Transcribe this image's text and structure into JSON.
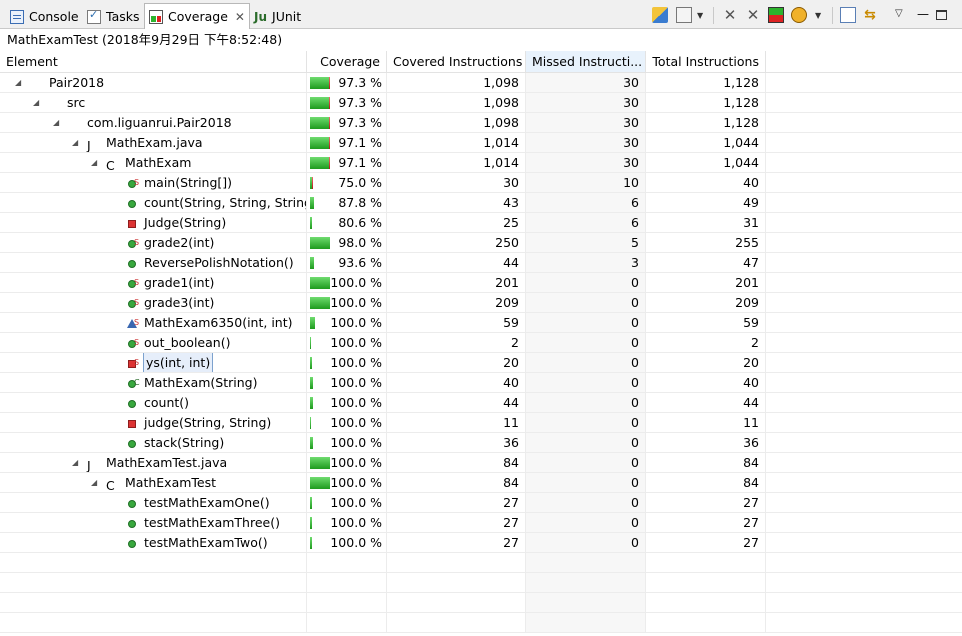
{
  "tabs": [
    {
      "label": "Console",
      "icon": "console-icon"
    },
    {
      "label": "Tasks",
      "icon": "tasks-icon"
    },
    {
      "label": "Coverage",
      "icon": "coverage-icon",
      "active": true
    },
    {
      "label": "JUnit",
      "icon": "junit-icon"
    }
  ],
  "session_title": "MathExamTest (2018年9月29日 下午8:52:48)",
  "columns": {
    "element": "Element",
    "coverage": "Coverage",
    "covered": "Covered Instructions",
    "missed": "Missed Instructi...",
    "total": "Total Instructions"
  },
  "rows": [
    {
      "label": "Pair2018",
      "type": "project",
      "depth": 0,
      "expanded": true,
      "coverage": "97.3 %",
      "pct": 97.3,
      "covered": "1,098",
      "missed": "30",
      "total": "1,128"
    },
    {
      "label": "src",
      "type": "source-folder",
      "depth": 1,
      "expanded": true,
      "coverage": "97.3 %",
      "pct": 97.3,
      "covered": "1,098",
      "missed": "30",
      "total": "1,128"
    },
    {
      "label": "com.liguanrui.Pair2018",
      "type": "package",
      "depth": 2,
      "expanded": true,
      "coverage": "97.3 %",
      "pct": 97.3,
      "covered": "1,098",
      "missed": "30",
      "total": "1,128"
    },
    {
      "label": "MathExam.java",
      "type": "java-file",
      "depth": 3,
      "expanded": true,
      "coverage": "97.1 %",
      "pct": 97.1,
      "covered": "1,014",
      "missed": "30",
      "total": "1,044"
    },
    {
      "label": "MathExam",
      "type": "class-main",
      "depth": 4,
      "expanded": true,
      "coverage": "97.1 %",
      "pct": 97.1,
      "covered": "1,014",
      "missed": "30",
      "total": "1,044"
    },
    {
      "label": "main(String[])",
      "type": "method-static",
      "depth": 5,
      "coverage": "75.0 %",
      "pct": 75.0,
      "covered": "30",
      "missed": "10",
      "total": "40"
    },
    {
      "label": "count(String, String, String)",
      "type": "method-public",
      "depth": 5,
      "coverage": "87.8 %",
      "pct": 87.8,
      "covered": "43",
      "missed": "6",
      "total": "49"
    },
    {
      "label": "Judge(String)",
      "type": "method-private",
      "depth": 5,
      "coverage": "80.6 %",
      "pct": 80.6,
      "covered": "25",
      "missed": "6",
      "total": "31"
    },
    {
      "label": "grade2(int)",
      "type": "method-static",
      "depth": 5,
      "coverage": "98.0 %",
      "pct": 98.0,
      "covered": "250",
      "missed": "5",
      "total": "255"
    },
    {
      "label": "ReversePolishNotation()",
      "type": "method-public",
      "depth": 5,
      "coverage": "93.6 %",
      "pct": 93.6,
      "covered": "44",
      "missed": "3",
      "total": "47"
    },
    {
      "label": "grade1(int)",
      "type": "method-static",
      "depth": 5,
      "coverage": "100.0 %",
      "pct": 100.0,
      "covered": "201",
      "missed": "0",
      "total": "201"
    },
    {
      "label": "grade3(int)",
      "type": "method-static",
      "depth": 5,
      "coverage": "100.0 %",
      "pct": 100.0,
      "covered": "209",
      "missed": "0",
      "total": "209"
    },
    {
      "label": "MathExam6350(int, int)",
      "type": "method-default",
      "depth": 5,
      "coverage": "100.0 %",
      "pct": 100.0,
      "covered": "59",
      "missed": "0",
      "total": "59"
    },
    {
      "label": "out_boolean()",
      "type": "method-static",
      "depth": 5,
      "coverage": "100.0 %",
      "pct": 100.0,
      "covered": "2",
      "missed": "0",
      "total": "2"
    },
    {
      "label": "ys(int, int)",
      "type": "method-private-static",
      "depth": 5,
      "selected": true,
      "coverage": "100.0 %",
      "pct": 100.0,
      "covered": "20",
      "missed": "0",
      "total": "20"
    },
    {
      "label": "MathExam(String)",
      "type": "method-constructor",
      "depth": 5,
      "coverage": "100.0 %",
      "pct": 100.0,
      "covered": "40",
      "missed": "0",
      "total": "40"
    },
    {
      "label": "count()",
      "type": "method-public",
      "depth": 5,
      "coverage": "100.0 %",
      "pct": 100.0,
      "covered": "44",
      "missed": "0",
      "total": "44"
    },
    {
      "label": "judge(String, String)",
      "type": "method-private",
      "depth": 5,
      "coverage": "100.0 %",
      "pct": 100.0,
      "covered": "11",
      "missed": "0",
      "total": "11"
    },
    {
      "label": "stack(String)",
      "type": "method-public",
      "depth": 5,
      "coverage": "100.0 %",
      "pct": 100.0,
      "covered": "36",
      "missed": "0",
      "total": "36"
    },
    {
      "label": "MathExamTest.java",
      "type": "java-file",
      "depth": 3,
      "expanded": true,
      "coverage": "100.0 %",
      "pct": 100.0,
      "covered": "84",
      "missed": "0",
      "total": "84"
    },
    {
      "label": "MathExamTest",
      "type": "class",
      "depth": 4,
      "expanded": true,
      "coverage": "100.0 %",
      "pct": 100.0,
      "covered": "84",
      "missed": "0",
      "total": "84"
    },
    {
      "label": "testMathExamOne()",
      "type": "method-public",
      "depth": 5,
      "coverage": "100.0 %",
      "pct": 100.0,
      "covered": "27",
      "missed": "0",
      "total": "27"
    },
    {
      "label": "testMathExamThree()",
      "type": "method-public",
      "depth": 5,
      "coverage": "100.0 %",
      "pct": 100.0,
      "covered": "27",
      "missed": "0",
      "total": "27"
    },
    {
      "label": "testMathExamTwo()",
      "type": "method-public",
      "depth": 5,
      "coverage": "100.0 %",
      "pct": 100.0,
      "covered": "27",
      "missed": "0",
      "total": "27"
    }
  ],
  "colors": {
    "covered_bar": "#2db32d",
    "missed_bar": "#d22222",
    "sorted_header": "#e8f2fc"
  }
}
